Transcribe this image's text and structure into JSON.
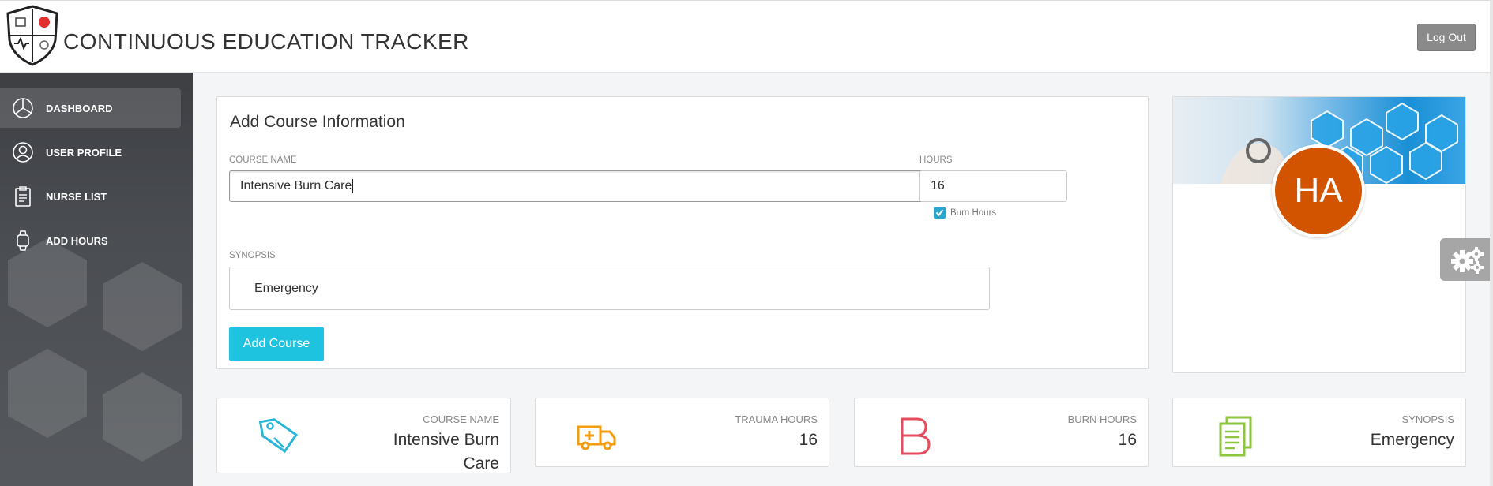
{
  "header": {
    "app_title": "CONTINUOUS EDUCATION TRACKER",
    "logout_label": "Log Out",
    "logo_icon": "shield-logo-icon"
  },
  "sidebar": {
    "items": [
      {
        "label": "DASHBOARD",
        "icon": "pie-chart-icon",
        "active": true
      },
      {
        "label": "USER PROFILE",
        "icon": "user-circle-icon",
        "active": false
      },
      {
        "label": "NURSE LIST",
        "icon": "clipboard-icon",
        "active": false
      },
      {
        "label": "ADD HOURS",
        "icon": "watch-icon",
        "active": false
      }
    ]
  },
  "form": {
    "title": "Add Course Information",
    "course_name_label": "COURSE NAME",
    "course_name_value": "Intensive Burn Care",
    "hours_label": "HOURS",
    "hours_value": "16",
    "burn_hours_label": "Burn Hours",
    "burn_hours_checked": true,
    "synopsis_label": "SYNOPSIS",
    "synopsis_value": "Emergency",
    "submit_label": "Add Course"
  },
  "profile": {
    "initials": "HA",
    "avatar_color": "#d35400"
  },
  "stats": [
    {
      "label": "COURSE NAME",
      "value": "Intensive Burn Care",
      "icon": "tag-icon",
      "color": "#29b6d6"
    },
    {
      "label": "TRAUMA HOURS",
      "value": "16",
      "icon": "ambulance-icon",
      "color": "#f39c12"
    },
    {
      "label": "BURN HOURS",
      "value": "16",
      "icon": "letter-b-icon",
      "color": "#e74c5c"
    },
    {
      "label": "SYNOPSIS",
      "value": "Emergency",
      "icon": "document-icon",
      "color": "#8cc63f"
    }
  ],
  "colors": {
    "accent_button": "#1ec3e0",
    "sidebar_bg": "#45484c",
    "logout_bg": "#8a8a8a",
    "checkbox": "#2ba6cb"
  }
}
